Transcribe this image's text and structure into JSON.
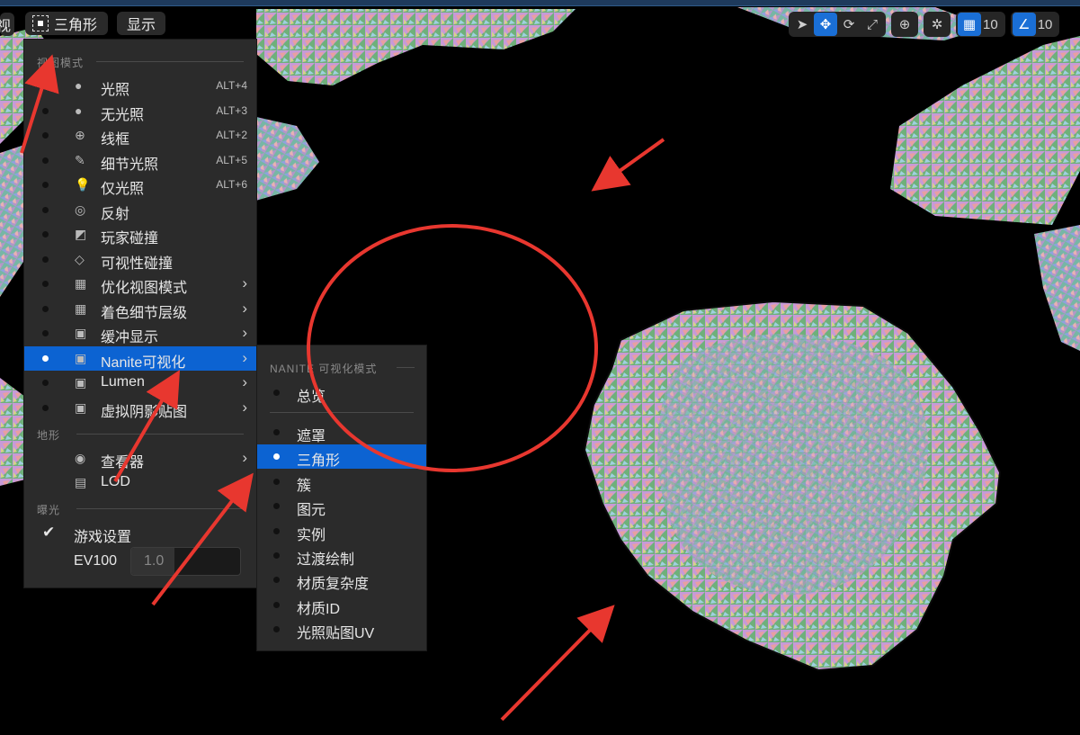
{
  "toolbar": {
    "left_partial": "视",
    "view_mode_label": "三角形",
    "show_label": "显示",
    "grid_value": "10",
    "angle_value": "10"
  },
  "menu": {
    "section_view_mode": "视图模式",
    "items": [
      {
        "label": "光照",
        "shortcut": "ALT+4",
        "icon": "sphere-lit-icon"
      },
      {
        "label": "无光照",
        "shortcut": "ALT+3",
        "icon": "sphere-unlit-icon"
      },
      {
        "label": "线框",
        "shortcut": "ALT+2",
        "icon": "wireframe-globe-icon"
      },
      {
        "label": "细节光照",
        "shortcut": "ALT+5",
        "icon": "detail-light-icon"
      },
      {
        "label": "仅光照",
        "shortcut": "ALT+6",
        "icon": "bulb-icon"
      },
      {
        "label": "反射",
        "shortcut": "",
        "icon": "reflection-icon"
      },
      {
        "label": "玩家碰撞",
        "shortcut": "",
        "icon": "player-collision-icon"
      },
      {
        "label": "可视性碰撞",
        "shortcut": "",
        "icon": "visibility-collision-icon"
      },
      {
        "label": "优化视图模式",
        "shortcut": "",
        "icon": "grid-icon",
        "submenu": true
      },
      {
        "label": "着色细节层级",
        "shortcut": "",
        "icon": "grid-icon",
        "submenu": true
      },
      {
        "label": "缓冲显示",
        "shortcut": "",
        "icon": "buffer-icon",
        "submenu": true
      },
      {
        "label": "Nanite可视化",
        "shortcut": "",
        "icon": "buffer-icon",
        "submenu": true,
        "selected": true
      },
      {
        "label": "Lumen",
        "shortcut": "",
        "icon": "buffer-icon",
        "submenu": true
      },
      {
        "label": "虚拟阴影贴图",
        "shortcut": "",
        "icon": "buffer-icon",
        "submenu": true
      }
    ],
    "section_terrain": "地形",
    "terrain_items": [
      {
        "label": "查看器",
        "icon": "viewer-icon",
        "submenu": true
      },
      {
        "label": "LOD",
        "icon": "lod-icon",
        "submenu": true
      }
    ],
    "section_exposure": "曝光",
    "game_settings_label": "游戏设置",
    "ev100_label": "EV100",
    "ev100_value": "1.0"
  },
  "submenu": {
    "header": "NANITE 可视化模式",
    "overview": "总览",
    "items": [
      "遮罩",
      "三角形",
      "簇",
      "图元",
      "实例",
      "过渡绘制",
      "材质复杂度",
      "材质ID",
      "光照贴图UV"
    ],
    "selected_index": 1
  },
  "colors": {
    "accent": "#0c63d2",
    "annotation_red": "#e8372f",
    "menu_bg": "#2b2b2b"
  }
}
